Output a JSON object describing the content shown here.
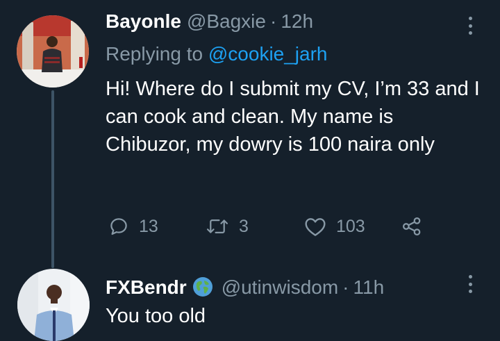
{
  "tweets": [
    {
      "display_name": "Bayonle",
      "handle": "@Bagxie",
      "separator": "·",
      "time": "12h",
      "replying_prefix": "Replying to",
      "replying_to": "@cookie_jarh",
      "text": "Hi! Where do I submit my CV, I’m 33 and I can cook and clean. My name is Chibuzor, my dowry is 100 naira only",
      "reply_count": "13",
      "retweet_count": "3",
      "like_count": "103",
      "icons": {
        "more": "more-vertical-icon",
        "reply": "reply-icon",
        "retweet": "retweet-icon",
        "like": "heart-icon",
        "share": "share-icon"
      }
    },
    {
      "display_name": "FXBendr",
      "handle": "@utinwisdom",
      "separator": "·",
      "time": "11h",
      "text": "You too old",
      "icons": {
        "badge": "globe-icon",
        "more": "more-vertical-icon"
      }
    }
  ],
  "colors": {
    "background": "#15202b",
    "primary_text": "#ffffff",
    "secondary_text": "#8899a6",
    "accent": "#1da1f2",
    "thread_line": "#3d5466"
  }
}
